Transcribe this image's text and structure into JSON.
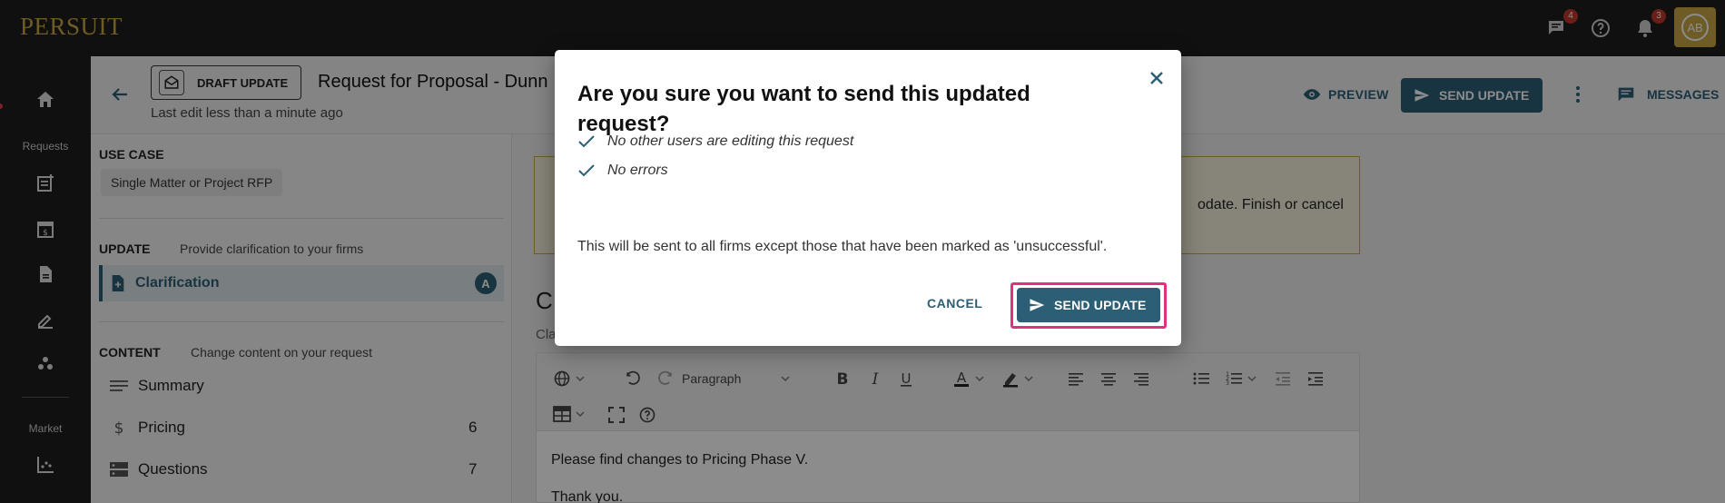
{
  "app": {
    "logo": "PERSUIT",
    "avatar_initials": "AB"
  },
  "topbar": {
    "messages_badge": "4",
    "notifications_badge": "3"
  },
  "rail": {
    "requests_label": "Requests",
    "market_label": "Market"
  },
  "header": {
    "draft_label": "DRAFT UPDATE",
    "title": "Request for Proposal - Dunn",
    "last_edit": "Last edit less than a minute ago",
    "preview_label": "PREVIEW",
    "send_update_label": "SEND UPDATE",
    "messages_label": "MESSAGES"
  },
  "panel": {
    "use_case_label": "USE CASE",
    "use_case_value": "Single Matter or Project RFP",
    "update_label": "UPDATE",
    "update_sub": "Provide clarification to your firms",
    "clarification_label": "Clarification",
    "clarification_badge": "A",
    "content_label": "CONTENT",
    "content_sub": "Change content on your request",
    "items": [
      {
        "label": "Summary",
        "count": ""
      },
      {
        "label": "Pricing",
        "count": "6"
      },
      {
        "label": "Questions",
        "count": "7"
      }
    ]
  },
  "main": {
    "warning_text": "odate. Finish or cancel",
    "heading_letter": "C",
    "clar_small": "Cla",
    "paragraph_style": "Paragraph",
    "editor_line1": "Please find changes to Pricing Phase V.",
    "editor_line2": "Thank you."
  },
  "modal": {
    "title": "Are you sure you want to send this updated request?",
    "checks": [
      "No other users are editing this request",
      "No errors"
    ],
    "body": "This will be sent to all firms except those that have been marked as 'unsuccessful'.",
    "cancel_label": "CANCEL",
    "send_label": "SEND UPDATE"
  },
  "colors": {
    "brand_gold": "#c9a646",
    "primary": "#2c5f75",
    "highlight": "#e0317d"
  }
}
